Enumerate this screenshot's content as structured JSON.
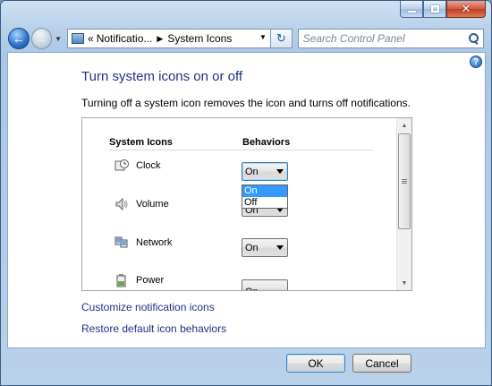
{
  "window": {
    "caption_minimize": "minimize",
    "caption_maximize": "maximize",
    "caption_close": "✕"
  },
  "nav": {
    "back_glyph": "←",
    "forward_glyph": "→",
    "address_prefix": "«",
    "breadcrumb_parent": "Notificatio...",
    "breadcrumb_sep": "▶",
    "breadcrumb_current": "System Icons",
    "refresh_glyph": "↻",
    "search_placeholder": "Search Control Panel"
  },
  "content": {
    "help_glyph": "?",
    "heading": "Turn system icons on or off",
    "description": "Turning off a system icon removes the icon and turns off notifications.",
    "columns": {
      "icons": "System Icons",
      "behaviors": "Behaviors"
    },
    "rows": [
      {
        "label": "Clock",
        "value": "On",
        "icon": "clock-icon"
      },
      {
        "label": "Volume",
        "value": "On",
        "icon": "volume-icon"
      },
      {
        "label": "Network",
        "value": "On",
        "icon": "network-icon"
      },
      {
        "label": "Power",
        "value": "On",
        "icon": "power-icon"
      }
    ],
    "dropdown_options": [
      "On",
      "Off"
    ],
    "dropdown_selected": "On",
    "link_customize": "Customize notification icons",
    "link_restore": "Restore default icon behaviors"
  },
  "buttons": {
    "ok": "OK",
    "cancel": "Cancel"
  },
  "colors": {
    "heading": "#1e3287",
    "link": "#1e3287",
    "selection": "#3399ff"
  }
}
